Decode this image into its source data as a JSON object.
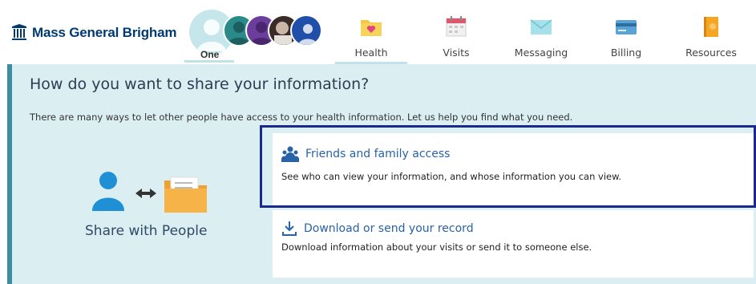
{
  "brand": {
    "name": "Mass General Brigham",
    "color": "#003a70"
  },
  "profile": {
    "label": "One"
  },
  "nav": [
    {
      "label": "Health",
      "icon": "health-folder-icon",
      "active": true
    },
    {
      "label": "Visits",
      "icon": "calendar-icon",
      "active": false
    },
    {
      "label": "Messaging",
      "icon": "envelope-icon",
      "active": false
    },
    {
      "label": "Billing",
      "icon": "credit-card-icon",
      "active": false
    },
    {
      "label": "Resources",
      "icon": "book-icon",
      "active": false
    }
  ],
  "page": {
    "title": "How do you want to share your information?",
    "subtitle": "There are many ways to let other people have access to your health information. Let us help you find what you need."
  },
  "share": {
    "label": "Share with People"
  },
  "cards": [
    {
      "title": "Friends and family access",
      "description": "See who can view your information, and whose information you can view.",
      "icon": "people-icon"
    },
    {
      "title": "Download or send your record",
      "description": "Download information about your visits or send it to someone else.",
      "icon": "download-icon"
    }
  ],
  "colors": {
    "accent": "#3b8ea0",
    "content_bg": "#dbeef2",
    "link": "#2a62a6",
    "highlight": "#1a2a8c"
  }
}
